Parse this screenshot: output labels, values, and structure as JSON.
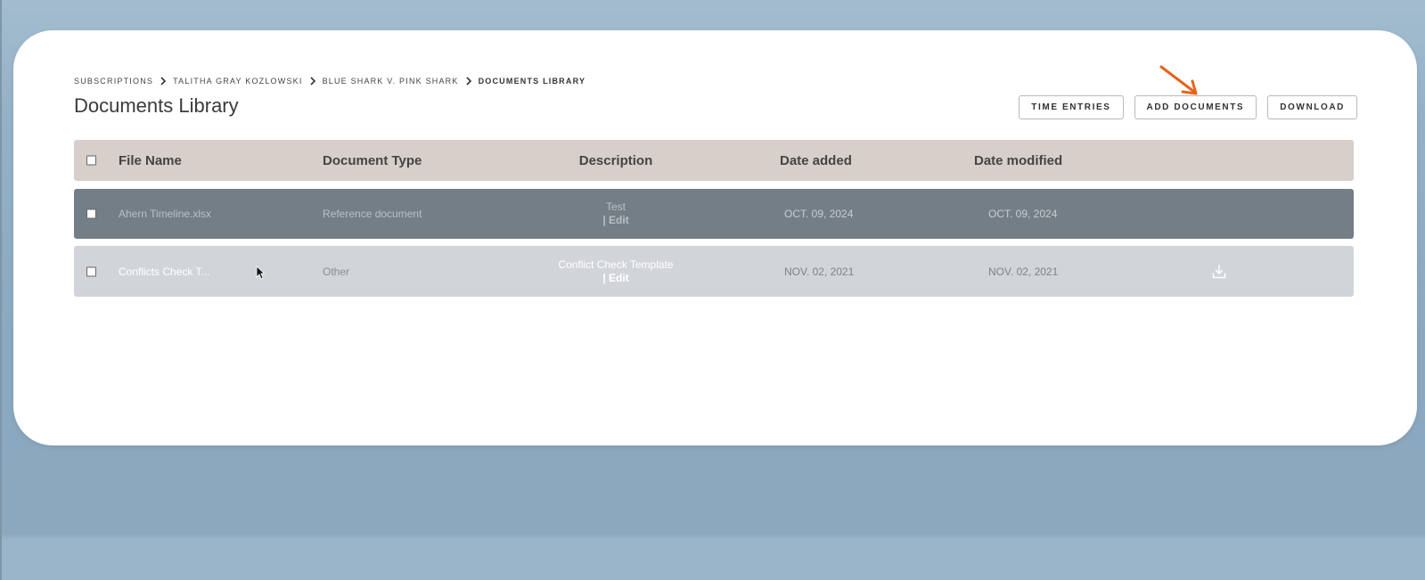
{
  "breadcrumb": [
    {
      "label": "SUBSCRIPTIONS"
    },
    {
      "label": "TALITHA GRAY KOZLOWSKI"
    },
    {
      "label": "BLUE SHARK V. PINK SHARK"
    },
    {
      "label": "DOCUMENTS LIBRARY"
    }
  ],
  "page": {
    "title": "Documents Library"
  },
  "toolbar": {
    "time_entries": "TIME ENTRIES",
    "add_documents": "ADD DOCUMENTS",
    "download": "DOWNLOAD"
  },
  "table": {
    "columns": {
      "file_name": "File Name",
      "document_type": "Document Type",
      "description": "Description",
      "date_added": "Date added",
      "date_modified": "Date modified"
    },
    "rows": [
      {
        "file_name": "Ahern Timeline.xlsx",
        "document_type": "Reference document",
        "description": "Test",
        "edit": "| Edit",
        "date_added": "OCT. 09, 2024",
        "date_modified": "OCT. 09, 2024"
      },
      {
        "file_name": "Conflicts Check T...",
        "document_type": "Other",
        "description": "Conflict Check Template",
        "edit": "| Edit",
        "date_added": "NOV. 02, 2021",
        "date_modified": "NOV. 02, 2021"
      }
    ]
  },
  "colors": {
    "header_row": "#d8cfca",
    "selected_row": "#737e87",
    "hover_row": "#d1d5d9",
    "annotation_arrow": "#e8621a"
  }
}
